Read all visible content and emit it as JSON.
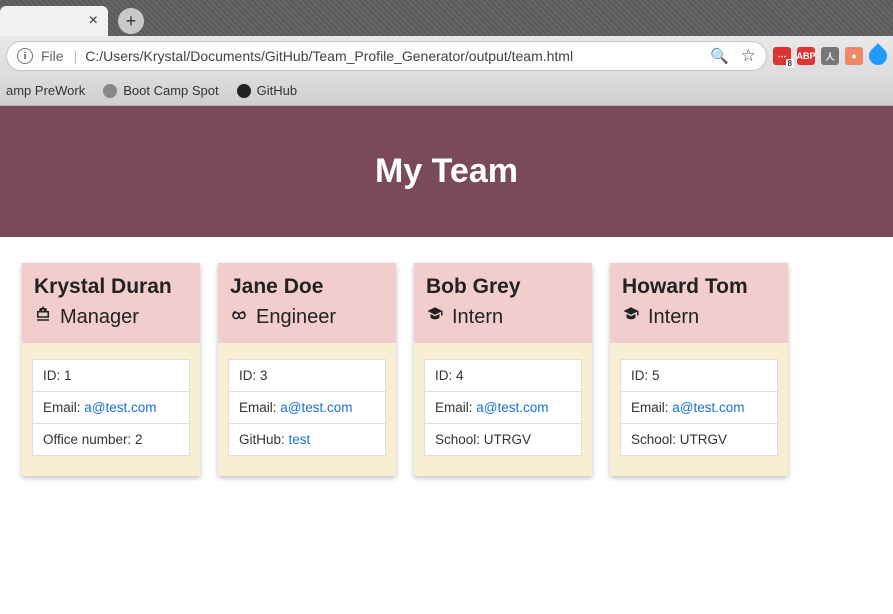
{
  "browser": {
    "file_label": "File",
    "url": "C:/Users/Krystal/Documents/GitHub/Team_Profile_Generator/output/team.html",
    "bookmarks": [
      {
        "label": "amp PreWork"
      },
      {
        "label": "Boot Camp Spot"
      },
      {
        "label": "GitHub"
      }
    ]
  },
  "header": {
    "title": "My Team"
  },
  "roles": {
    "manager": "Manager",
    "engineer": "Engineer",
    "intern": "Intern"
  },
  "labels": {
    "id": "ID: ",
    "email": "Email: ",
    "office": "Office number: ",
    "github": "GitHub: ",
    "school": "School: "
  },
  "team": [
    {
      "name": "Krystal Duran",
      "role": "manager",
      "id": "1",
      "email": "a@test.com",
      "extraLabel": "office",
      "extraValue": "2",
      "extraLink": false
    },
    {
      "name": "Jane Doe",
      "role": "engineer",
      "id": "3",
      "email": "a@test.com",
      "extraLabel": "github",
      "extraValue": "test",
      "extraLink": true
    },
    {
      "name": "Bob Grey",
      "role": "intern",
      "id": "4",
      "email": "a@test.com",
      "extraLabel": "school",
      "extraValue": "UTRGV",
      "extraLink": false
    },
    {
      "name": "Howard Tom",
      "role": "intern",
      "id": "5",
      "email": "a@test.com",
      "extraLabel": "school",
      "extraValue": "UTRGV",
      "extraLink": false
    }
  ]
}
